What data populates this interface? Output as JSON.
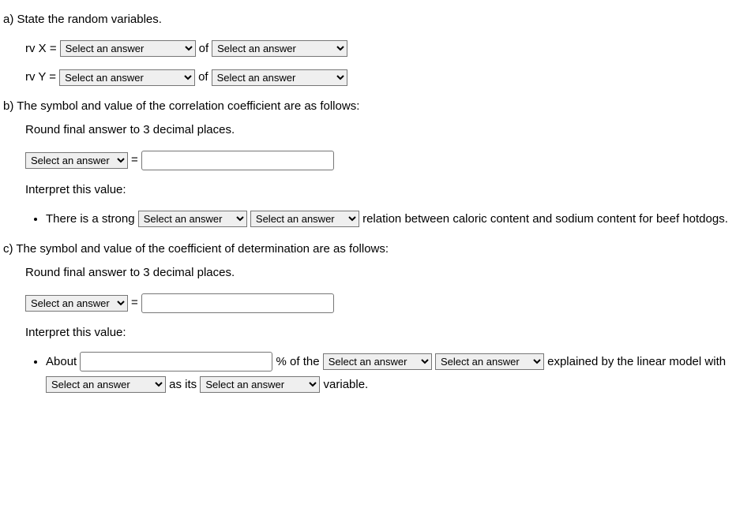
{
  "a": {
    "prompt": "a) State the random variables.",
    "rvX_label": "rv X =",
    "rvY_label": "rv Y =",
    "of_label": "of",
    "select_placeholder": "Select an answer"
  },
  "b": {
    "prompt": "b) The symbol and value of the correlation coefficient are as follows:",
    "round_text": "Round final answer to 3 decimal places.",
    "equals": "=",
    "select_placeholder": "Select an answer",
    "interpret_label": "Interpret this value:",
    "strong_prefix": "There is a strong",
    "strong_suffix": "relation between caloric content and sodium content for beef hotdogs."
  },
  "c": {
    "prompt": "c) The symbol and value of the coefficient of determination are as follows:",
    "round_text": "Round final answer to 3 decimal places.",
    "equals": "=",
    "select_placeholder": "Select an answer",
    "interpret_label": "Interpret this value:",
    "about_label": "About",
    "percent_of_the": "% of the",
    "explained_by": "explained by the linear model with",
    "as_its": "as its",
    "variable_end": "variable."
  }
}
